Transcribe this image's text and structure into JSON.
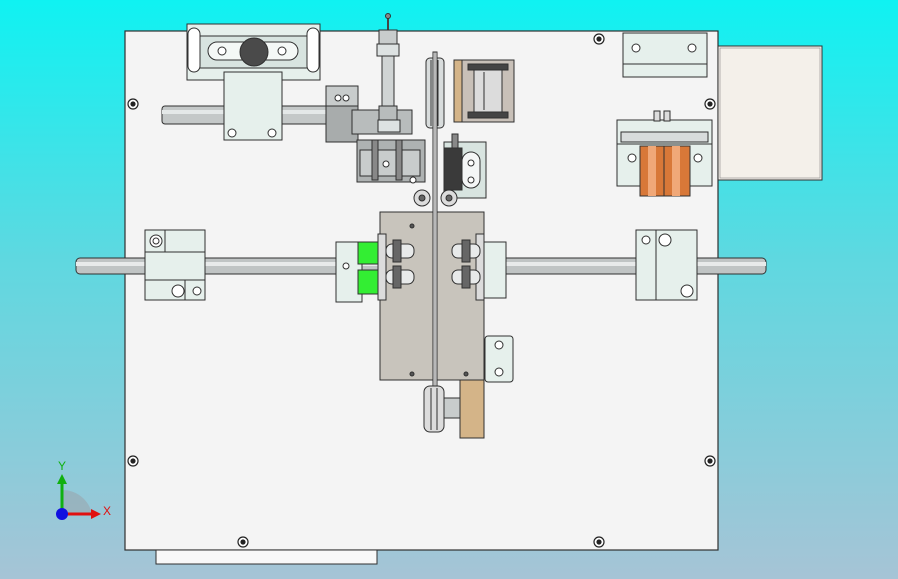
{
  "viewport": {
    "background_top": "#00f0f0",
    "background_bottom": "#a8c4d8"
  },
  "colors": {
    "plate": "#f4f4f4",
    "plate_edge": "#303030",
    "part_light": "#e6f0ec",
    "part_mid": "#c8ccc8",
    "part_dark": "#5a5a5a",
    "shaft": "#b8bcbc",
    "green_block": "#33ee33",
    "bronze": "#d4b488",
    "copper": "#d87838",
    "motor_body": "#c0b8b0"
  },
  "triad": {
    "x_label": "X",
    "y_label": "Y",
    "x_color": "#e01010",
    "y_color": "#10b010",
    "z_color": "#1010e0"
  }
}
